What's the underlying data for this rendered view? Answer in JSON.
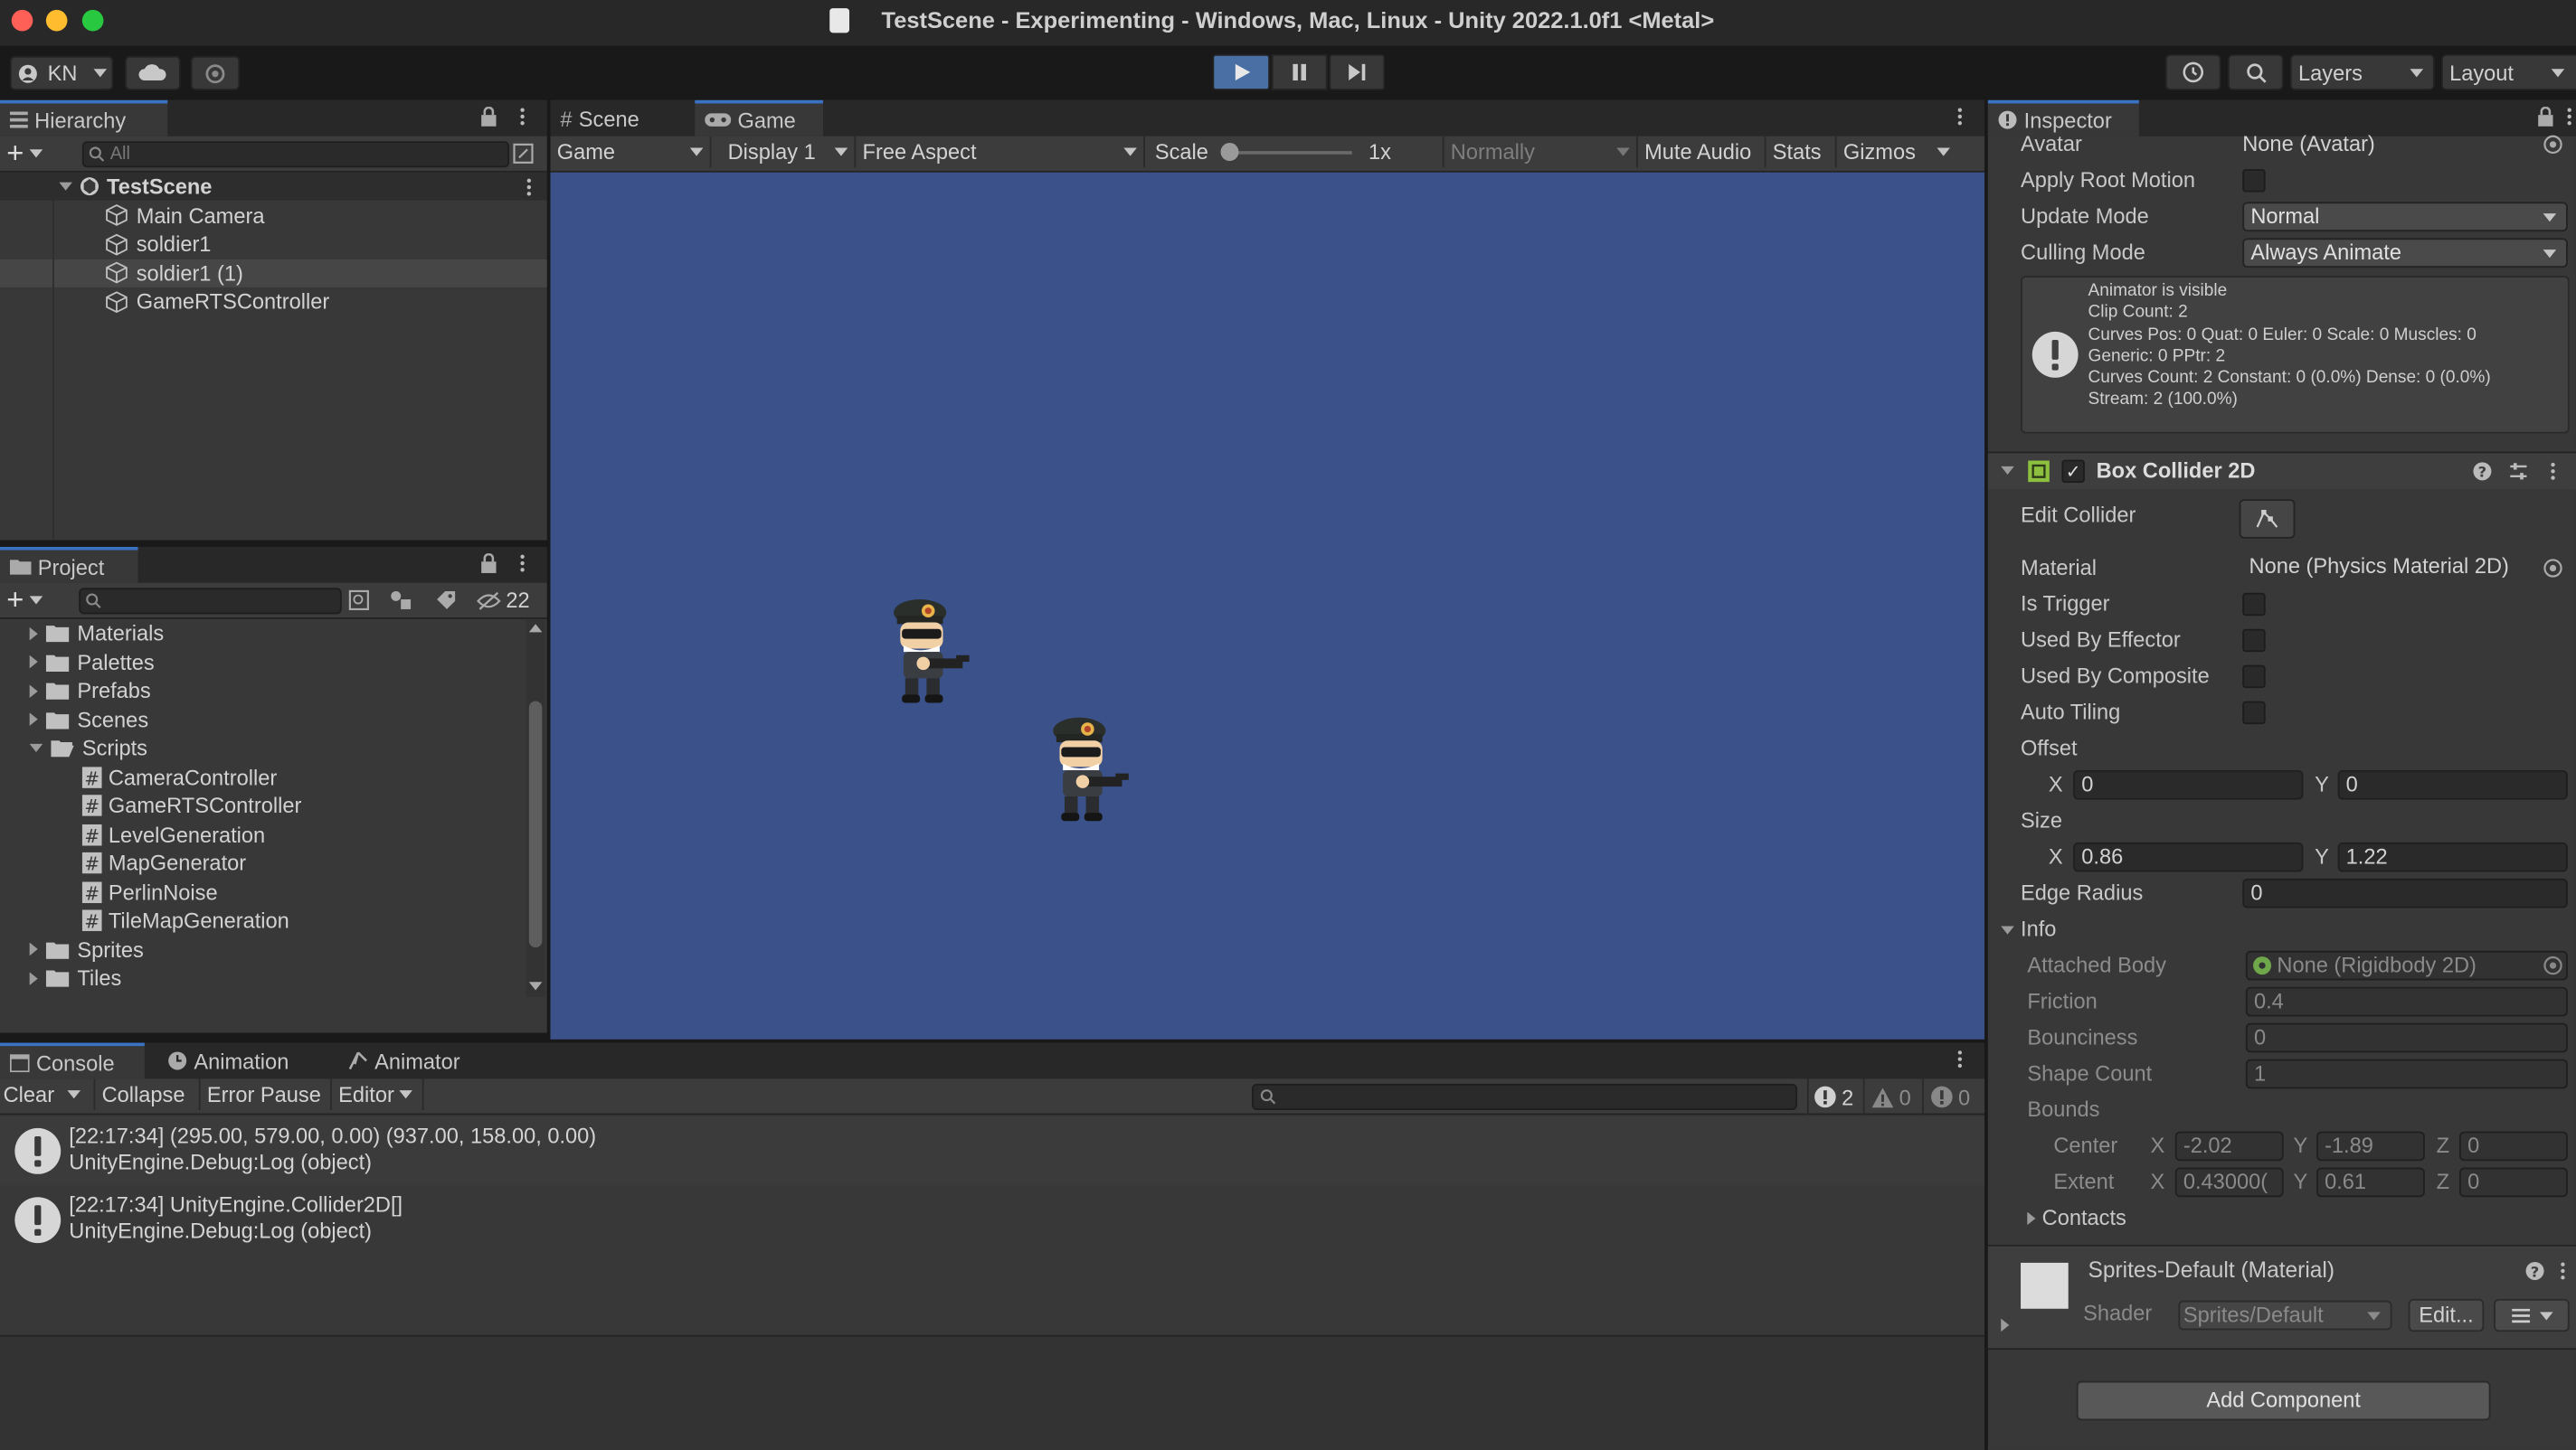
{
  "window": {
    "title": "TestScene - Experimenting - Windows, Mac, Linux - Unity 2022.1.0f1 <Metal>"
  },
  "toolbar": {
    "account": "KN",
    "layers_label": "Layers",
    "layout_label": "Layout"
  },
  "hierarchy": {
    "tab": "Hierarchy",
    "search_placeholder": "All",
    "scene": "TestScene",
    "items": [
      "Main Camera",
      "soldier1",
      "soldier1 (1)",
      "GameRTSController"
    ]
  },
  "project": {
    "tab": "Project",
    "hidden_count": "22",
    "folders_top": [
      "Materials",
      "Palettes",
      "Prefabs",
      "Scenes",
      "Scripts"
    ],
    "scripts": [
      "CameraController",
      "GameRTSController",
      "LevelGeneration",
      "MapGenerator",
      "PerlinNoise",
      "TileMapGeneration"
    ],
    "folders_bottom": [
      "Sprites",
      "Tiles"
    ]
  },
  "game": {
    "tabs": [
      "Scene",
      "Game"
    ],
    "view_select": "Game",
    "display_select": "Display 1",
    "aspect_select": "Free Aspect",
    "scale_label": "Scale",
    "scale_value": "1x",
    "play_focus": "Normally",
    "mute_audio": "Mute Audio",
    "stats": "Stats",
    "gizmos": "Gizmos",
    "background": "#3a5289"
  },
  "console": {
    "tabs": [
      "Console",
      "Animation",
      "Animator"
    ],
    "clear": "Clear",
    "collapse": "Collapse",
    "error_pause": "Error Pause",
    "editor": "Editor",
    "count_logs": "2",
    "count_warnings": "0",
    "count_errors": "0",
    "entries": [
      {
        "line1": "[22:17:34] (295.00, 579.00, 0.00) (937.00, 158.00, 0.00)",
        "line2": "UnityEngine.Debug:Log (object)"
      },
      {
        "line1": "[22:17:34] UnityEngine.Collider2D[]",
        "line2": "UnityEngine.Debug:Log (object)"
      }
    ]
  },
  "inspector": {
    "tab": "Inspector",
    "animator": {
      "avatar_label": "Avatar",
      "avatar_value": "None (Avatar)",
      "root_motion_label": "Apply Root Motion",
      "update_mode_label": "Update Mode",
      "update_mode_value": "Normal",
      "culling_mode_label": "Culling Mode",
      "culling_mode_value": "Always Animate",
      "info_lines": [
        "Animator is visible",
        "Clip Count: 2",
        "Curves Pos: 0 Quat: 0 Euler: 0 Scale: 0 Muscles: 0",
        "Generic: 0 PPtr: 2",
        "Curves Count: 2 Constant: 0 (0.0%) Dense: 0 (0.0%)",
        "Stream: 2 (100.0%)"
      ]
    },
    "box_collider": {
      "title": "Box Collider 2D",
      "edit_collider": "Edit Collider",
      "material_label": "Material",
      "material_value": "None (Physics Material 2D)",
      "is_trigger": "Is Trigger",
      "used_by_effector": "Used By Effector",
      "used_by_composite": "Used By Composite",
      "auto_tiling": "Auto Tiling",
      "offset_label": "Offset",
      "offset_x": "0",
      "offset_y": "0",
      "size_label": "Size",
      "size_x": "0.86",
      "size_y": "1.22",
      "edge_radius_label": "Edge Radius",
      "edge_radius": "0",
      "info_label": "Info",
      "attached_body_label": "Attached Body",
      "attached_body": "None (Rigidbody 2D)",
      "friction_label": "Friction",
      "friction": "0.4",
      "bounciness_label": "Bounciness",
      "bounciness": "0",
      "shape_count_label": "Shape Count",
      "shape_count": "1",
      "bounds_label": "Bounds",
      "center_label": "Center",
      "center_x": "-2.02",
      "center_y": "-1.89",
      "center_z": "0",
      "extent_label": "Extent",
      "extent_x": "0.43000(",
      "extent_y": "0.61",
      "extent_z": "0",
      "contacts_label": "Contacts",
      "x": "X",
      "y": "Y",
      "z": "Z"
    },
    "material": {
      "title": "Sprites-Default (Material)",
      "shader_label": "Shader",
      "shader_value": "Sprites/Default",
      "edit_button": "Edit..."
    },
    "add_component": "Add Component"
  }
}
